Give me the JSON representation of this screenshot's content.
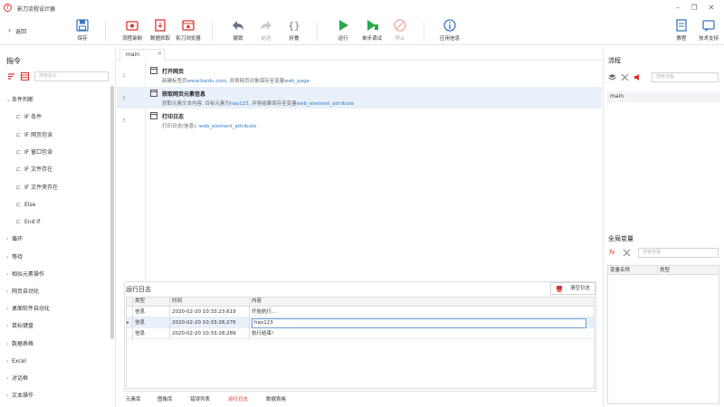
{
  "window": {
    "title": "影刀流程设计器",
    "logo_glyph": "Y",
    "min": "–",
    "restore": "❐",
    "close": "✕"
  },
  "toolbar": {
    "back": "返回",
    "buttons": [
      {
        "id": "save",
        "label": "保存",
        "icon": "save-icon",
        "disabled": false
      },
      {
        "id": "record",
        "label": "流程录制",
        "icon": "record-icon",
        "disabled": false
      },
      {
        "id": "scrape",
        "label": "数据抓取",
        "icon": "scrape-icon",
        "disabled": false
      },
      {
        "id": "browser",
        "label": "影刀浏览器",
        "icon": "browser-icon",
        "disabled": false
      },
      {
        "id": "undo",
        "label": "撤销",
        "icon": "undo-icon",
        "disabled": false
      },
      {
        "id": "redo",
        "label": "前进",
        "icon": "redo-icon",
        "disabled": true
      },
      {
        "id": "fold",
        "label": "折叠",
        "icon": "braces-icon",
        "disabled": false
      },
      {
        "id": "run",
        "label": "运行",
        "icon": "play-icon",
        "disabled": false
      },
      {
        "id": "step",
        "label": "单步调试",
        "icon": "step-icon",
        "disabled": false
      },
      {
        "id": "stop",
        "label": "停止",
        "icon": "stop-icon",
        "disabled": true
      },
      {
        "id": "info",
        "label": "应用信息",
        "icon": "info-icon",
        "disabled": false
      },
      {
        "id": "tutorial",
        "label": "教程",
        "icon": "tutorial-icon",
        "disabled": false
      },
      {
        "id": "support",
        "label": "技术支持",
        "icon": "support-icon",
        "disabled": false
      }
    ]
  },
  "left": {
    "title": "指令",
    "search_placeholder": "搜索指令",
    "tree": [
      {
        "label": "条件判断",
        "level": 0,
        "expanded": true
      },
      {
        "label": "IF 条件",
        "level": 1
      },
      {
        "label": "IF 网页包含",
        "level": 1
      },
      {
        "label": "IF 窗口包含",
        "level": 1
      },
      {
        "label": "IF 文件存在",
        "level": 1
      },
      {
        "label": "IF 文件夹存在",
        "level": 1
      },
      {
        "label": "Else",
        "level": 1
      },
      {
        "label": "End If",
        "level": 1
      },
      {
        "label": "循环",
        "level": 0
      },
      {
        "label": "等待",
        "level": 0
      },
      {
        "label": "相似元素操作",
        "level": 0
      },
      {
        "label": "网页自动化",
        "level": 0
      },
      {
        "label": "桌面软件自动化",
        "level": 0
      },
      {
        "label": "鼠标键盘",
        "level": 0
      },
      {
        "label": "数据表格",
        "level": 0
      },
      {
        "label": "Excel",
        "level": 0
      },
      {
        "label": "对话框",
        "level": 0
      },
      {
        "label": "文本操作",
        "level": 0
      }
    ]
  },
  "editor": {
    "tab": "main",
    "tab_close": "✕",
    "steps": [
      {
        "num": "1",
        "title": "打开网页",
        "desc_pre": "新建标签页",
        "desc_link1": "www.baidu.com",
        "desc_mid": ", 并将网页对象保存至变量",
        "desc_link2": "web_page",
        "selected": false
      },
      {
        "num": "2",
        "title": "获取网页元素信息",
        "desc_pre": "获取元素文本内容, 目标元素为",
        "desc_link1": "hao123",
        "desc_mid": ", 并将结果保存至变量",
        "desc_link2": "web_element_attribute",
        "selected": true
      },
      {
        "num": "3",
        "title": "打印日志",
        "desc_pre": "打印日志(信息): ",
        "desc_link1": "web_element_attribute",
        "desc_mid": "",
        "desc_link2": "",
        "selected": false
      }
    ]
  },
  "log": {
    "title": "运行日志",
    "clear_label": "清空日志",
    "headers": [
      "类型",
      "时间",
      "内容"
    ],
    "rows": [
      {
        "type": "信息",
        "time": "2020-02-20 10:33:23,619",
        "content": "开始执行...",
        "selected": false
      },
      {
        "type": "信息",
        "time": "2020-02-20 10:33:28,276",
        "content": "hao123",
        "selected": true
      },
      {
        "type": "信息",
        "time": "2020-02-20 10:33:28,289",
        "content": "执行结束!",
        "selected": false
      }
    ]
  },
  "bottom_tabs": [
    {
      "label": "元素库",
      "active": false
    },
    {
      "label": "图像库",
      "active": false
    },
    {
      "label": "错误列表",
      "active": false
    },
    {
      "label": "运行日志",
      "active": true
    },
    {
      "label": "数据表格",
      "active": false
    }
  ],
  "right": {
    "flow_title": "流程",
    "flow_search_placeholder": "搜索流程",
    "flows": [
      "main"
    ],
    "vars_title": "全局变量",
    "vars_search_placeholder": "搜索变量",
    "vars_headers": [
      "变量名称",
      "类型"
    ]
  },
  "colors": {
    "accent": "#d9342b",
    "link": "#2e7ec8",
    "run": "#2aa84a",
    "selected_row": "#e8f0fa"
  }
}
